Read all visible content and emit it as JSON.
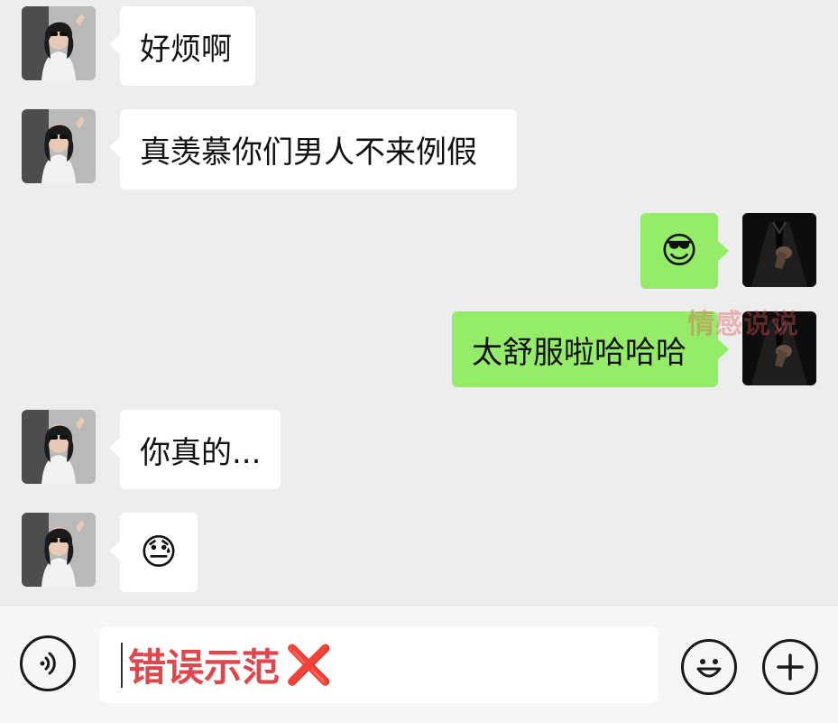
{
  "messages": [
    {
      "sender": "her",
      "text": "好烦啊"
    },
    {
      "sender": "her",
      "text": "真羡慕你们男人不来例假"
    },
    {
      "sender": "me",
      "emoji": "😎"
    },
    {
      "sender": "me",
      "text": "太舒服啦哈哈哈"
    },
    {
      "sender": "her",
      "text": "你真的..."
    },
    {
      "sender": "her",
      "emoji": "😓"
    }
  ],
  "watermark": "情感说说",
  "input": {
    "value": "错误示范",
    "suffix_emoji": "❌"
  },
  "icons": {
    "voice": "voice-icon",
    "emoji": "emoji-icon",
    "add": "add-icon"
  },
  "colors": {
    "background": "#ededed",
    "incoming_bubble": "#ffffff",
    "outgoing_bubble": "#95ec69",
    "input_text": "#e0474c"
  }
}
